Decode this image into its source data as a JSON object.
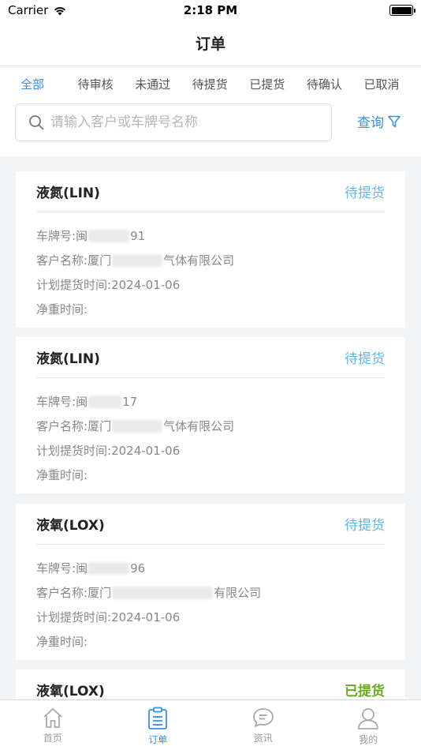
{
  "status_bar": {
    "carrier": "Carrier",
    "time": "2:18 PM"
  },
  "nav": {
    "title": "订单"
  },
  "tabs": [
    {
      "label": "全部",
      "active": true
    },
    {
      "label": "待审核"
    },
    {
      "label": "未通过"
    },
    {
      "label": "待提货"
    },
    {
      "label": "已提货"
    },
    {
      "label": "待确认"
    },
    {
      "label": "已取消"
    }
  ],
  "search": {
    "placeholder": "请输入客户或车牌号名称",
    "query_label": "查询"
  },
  "orders": [
    {
      "title": "液氮(LIN)",
      "status": "待提货",
      "plate_label": "车牌号:",
      "plate_prefix": "闽",
      "plate_suffix": "91",
      "customer_label": "客户名称:",
      "customer_prefix": "厦门",
      "customer_suffix": "气体有限公司",
      "plan_label": "计划提货时间:",
      "plan_date": "2024-01-06",
      "net_label": "净重时间:"
    },
    {
      "title": "液氮(LIN)",
      "status": "待提货",
      "plate_label": "车牌号:",
      "plate_prefix": "闽",
      "plate_suffix": "17",
      "customer_label": "客户名称:",
      "customer_prefix": "厦门",
      "customer_suffix": "气体有限公司",
      "plan_label": "计划提货时间:",
      "plan_date": "2024-01-06",
      "net_label": "净重时间:"
    },
    {
      "title": "液氧(LOX)",
      "status": "待提货",
      "plate_label": "车牌号:",
      "plate_prefix": "闽",
      "plate_suffix": "96",
      "customer_label": "客户名称:",
      "customer_prefix": "厦门",
      "customer_suffix": "有限公司",
      "plan_label": "计划提货时间:",
      "plan_date": "2024-01-06",
      "net_label": "净重时间:"
    },
    {
      "title": "液氧(LOX)",
      "status": "已提货"
    }
  ],
  "tab_bar": [
    {
      "label": "首页",
      "icon": "home-icon"
    },
    {
      "label": "订单",
      "icon": "order-icon",
      "active": true
    },
    {
      "label": "资讯",
      "icon": "chat-icon"
    },
    {
      "label": "我的",
      "icon": "user-icon"
    }
  ],
  "colors": {
    "accent": "#3b8fe0",
    "pending": "#62b7e8",
    "done": "#6aa81e"
  }
}
